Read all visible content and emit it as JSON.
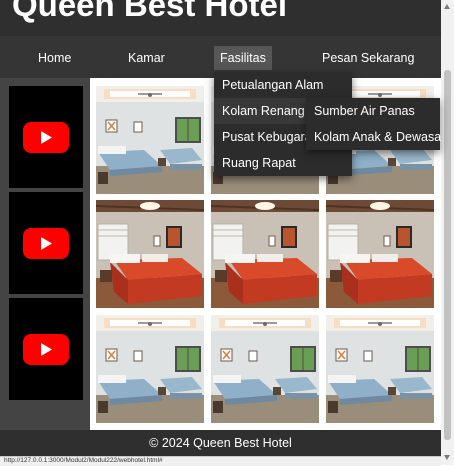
{
  "header": {
    "title": "Queen Best Hotel"
  },
  "nav": {
    "home": "Home",
    "kamar": "Kamar",
    "fasilitas": "Fasilitas",
    "pesan": "Pesan Sekarang"
  },
  "dropdown": {
    "items": [
      "Petualangan Alam",
      "Kolam Renang",
      "Pusat Kebugaran",
      "Ruang Rapat"
    ],
    "submenu": [
      "Sumber Air Panas",
      "Kolam Anak & Dewasa"
    ]
  },
  "sidebar": {
    "videos": [
      "youtube-video",
      "youtube-video",
      "youtube-video"
    ]
  },
  "gallery": {
    "rows": [
      [
        "blue-bedroom",
        "blue-bedroom",
        "blue-bedroom"
      ],
      [
        "red-bedroom",
        "red-bedroom",
        "red-bedroom"
      ],
      [
        "blue-bedroom",
        "blue-bedroom",
        "blue-bedroom"
      ]
    ]
  },
  "footer": {
    "text": "© 2024 Queen Best Hotel"
  },
  "status": {
    "url": "http://127.0.0.1:3000/Modul2/Modul222/webhotel.html#"
  },
  "colors": {
    "youtube_red": "#ff0000",
    "nav_bg": "#353535",
    "active_tab": "#575757"
  }
}
